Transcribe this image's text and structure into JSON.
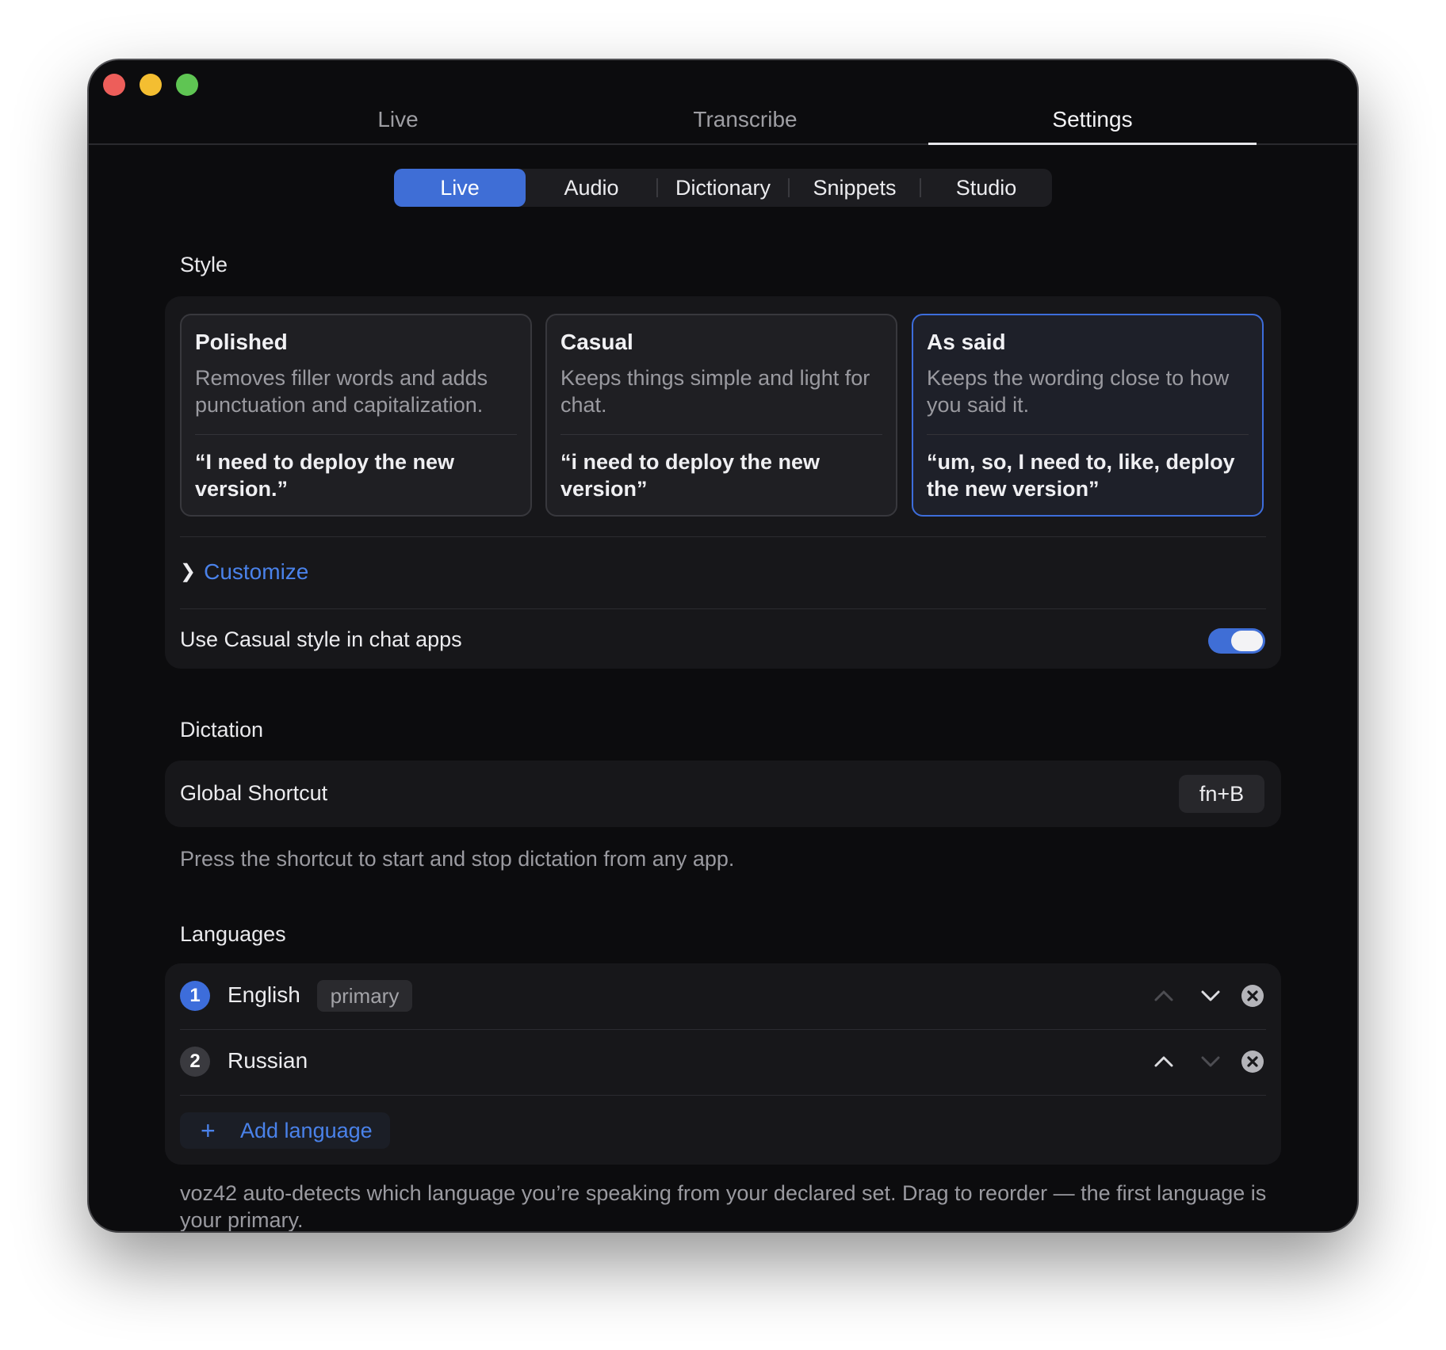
{
  "window": {
    "controls": [
      "close",
      "minimize",
      "zoom"
    ]
  },
  "top_tabs": [
    {
      "label": "Live",
      "active": false
    },
    {
      "label": "Transcribe",
      "active": false
    },
    {
      "label": "Settings",
      "active": true
    }
  ],
  "sub_tabs": [
    {
      "label": "Live",
      "active": true
    },
    {
      "label": "Audio",
      "active": false
    },
    {
      "label": "Dictionary",
      "active": false
    },
    {
      "label": "Snippets",
      "active": false
    },
    {
      "label": "Studio",
      "active": false
    }
  ],
  "style": {
    "title": "Style",
    "cards": [
      {
        "title": "Polished",
        "description": "Removes filler words and adds punctuation and capitalization.",
        "example": "“I need to deploy the new version.”",
        "selected": false
      },
      {
        "title": "Casual",
        "description": "Keeps things simple and light for chat.",
        "example": "“i need to deploy the new version”",
        "selected": false
      },
      {
        "title": "As said",
        "description": "Keeps the wording close to how you said it.",
        "example": "“um, so, I need to, like, deploy the new version”",
        "selected": true
      }
    ],
    "customize_label": "Customize",
    "customize_icon": "chevron-right-icon",
    "chat_toggle_label": "Use Casual style in chat apps",
    "chat_toggle_on": true
  },
  "dictation": {
    "title": "Dictation",
    "shortcut_label": "Global Shortcut",
    "shortcut_value": "fn+B",
    "help": "Press the shortcut to start and stop dictation from any app."
  },
  "languages": {
    "title": "Languages",
    "items": [
      {
        "number": "1",
        "name": "English",
        "badge": "primary",
        "can_move_up": false,
        "can_move_down": true
      },
      {
        "number": "2",
        "name": "Russian",
        "badge": "",
        "can_move_up": true,
        "can_move_down": false
      }
    ],
    "add_label": "Add language",
    "add_icon": "plus-icon",
    "help": "voz42 auto-detects which language you’re speaking from your declared set. Drag to reorder — the first language is your primary."
  },
  "colors": {
    "accent": "#3f6ed6",
    "link": "#4a82ea",
    "window_bg": "#0c0c0e",
    "panel_bg": "#17171a",
    "traffic_close": "#ed5e5a",
    "traffic_minimize": "#f4be31",
    "traffic_zoom": "#5fc553"
  }
}
